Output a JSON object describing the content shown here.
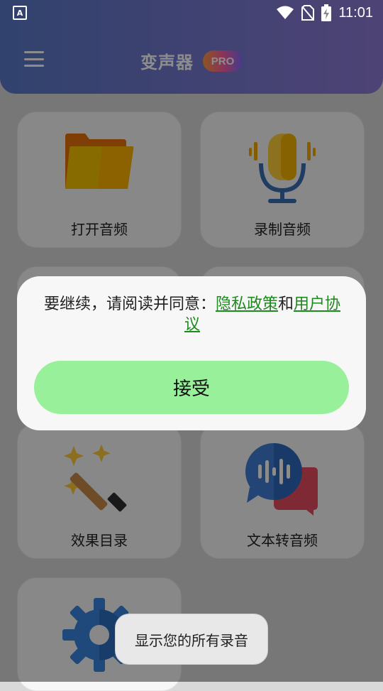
{
  "status_bar": {
    "time": "11:01",
    "app_icon_letter": "A"
  },
  "header": {
    "title": "变声器",
    "pro_badge": "PRO"
  },
  "cards": [
    {
      "label": "打开音频",
      "icon": "folder-icon"
    },
    {
      "label": "录制音频",
      "icon": "microphone-icon"
    },
    {
      "label": "效果目录",
      "icon": "magic-wand-icon"
    },
    {
      "label": "文本转音频",
      "icon": "speech-bubble-icon"
    },
    {
      "label": "",
      "icon": "settings-gear-icon"
    }
  ],
  "dialog": {
    "prefix": "要继续，请阅读并同意：",
    "privacy_link": "隐私政策",
    "and": "和",
    "terms_link": "用户协议",
    "accept_button": "接受"
  },
  "toast": {
    "message": "显示您的所有录音"
  },
  "colors": {
    "header_start": "#5a78c8",
    "header_end": "#8e7bd6",
    "accept": "#98f19a",
    "link": "#1c8a1c"
  }
}
